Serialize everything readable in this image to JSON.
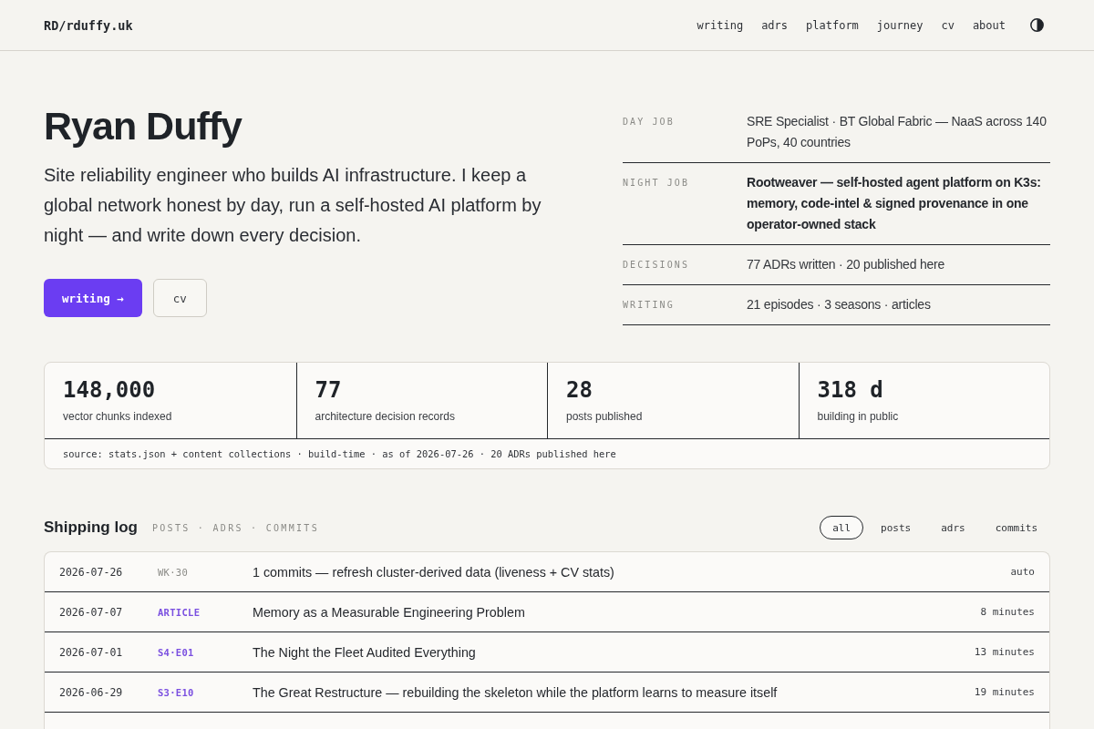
{
  "header": {
    "logo": "RD/rduffy.uk",
    "nav": [
      "writing",
      "adrs",
      "platform",
      "journey",
      "cv",
      "about"
    ]
  },
  "hero": {
    "name": "Ryan Duffy",
    "intro": "Site reliability engineer who builds AI infrastructure. I keep a global network honest by day, run a self-hosted AI platform by night — and write down every decision.",
    "buttons": [
      {
        "label": "writing →",
        "kind": "primary"
      },
      {
        "label": "cv",
        "kind": "secondary"
      }
    ],
    "facts": [
      {
        "label": "DAY JOB",
        "value": "SRE Specialist · BT Global Fabric — NaaS across 140 PoPs, 40 countries",
        "bold": false
      },
      {
        "label": "NIGHT JOB",
        "value": "Rootweaver — self-hosted agent platform on K3s: memory, code-intel & signed provenance in one operator-owned stack",
        "bold": true
      },
      {
        "label": "DECISIONS",
        "value": "77 ADRs written · 20 published here",
        "bold": false
      },
      {
        "label": "WRITING",
        "value": "21 episodes · 3 seasons · articles",
        "bold": false
      }
    ]
  },
  "stats": {
    "items": [
      {
        "value": "148,000",
        "label": "vector chunks indexed"
      },
      {
        "value": "77",
        "label": "architecture decision records"
      },
      {
        "value": "28",
        "label": "posts published"
      },
      {
        "value": "318 d",
        "label": "building in public"
      }
    ],
    "source": "source: stats.json + content collections · build-time · as of 2026-07-26 · 20 ADRs published here"
  },
  "shipping_log": {
    "title": "Shipping log",
    "subtitle": "POSTS · ADRS · COMMITS",
    "filters": [
      {
        "label": "all",
        "selected": true
      },
      {
        "label": "posts",
        "selected": false
      },
      {
        "label": "adrs",
        "selected": false
      },
      {
        "label": "commits",
        "selected": false
      }
    ],
    "rows": [
      {
        "date": "2026-07-26",
        "tag": "WK·30",
        "kind": "commit",
        "title": "1 commits — refresh cluster-derived data (liveness + CV stats)",
        "meta": "auto"
      },
      {
        "date": "2026-07-07",
        "tag": "ARTICLE",
        "kind": "post",
        "title": "Memory as a Measurable Engineering Problem",
        "meta": "8 minutes"
      },
      {
        "date": "2026-07-01",
        "tag": "S4·E01",
        "kind": "post",
        "title": "The Night the Fleet Audited Everything",
        "meta": "13 minutes"
      },
      {
        "date": "2026-06-29",
        "tag": "S3·E10",
        "kind": "post",
        "title": "The Great Restructure — rebuilding the skeleton while the platform learns to measure itself",
        "meta": "19 minutes"
      }
    ]
  }
}
